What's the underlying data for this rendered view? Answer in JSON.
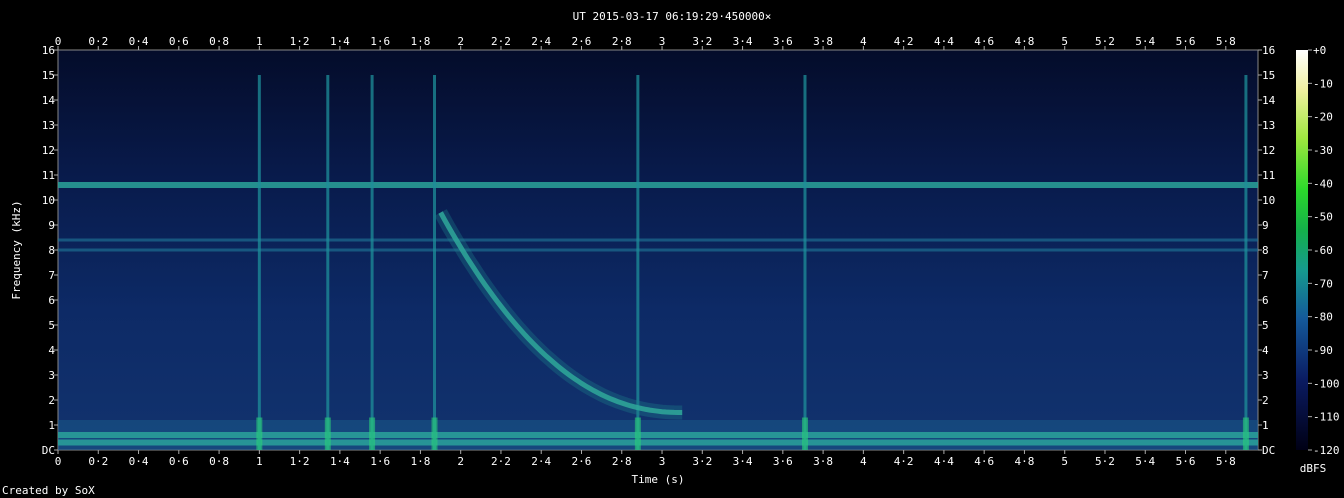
{
  "chart_data": {
    "type": "heatmap",
    "title": "UT 2015-03-17 06:19:29·450000×",
    "xlabel": "Time (s)",
    "ylabel": "Frequency (kHz)",
    "colorbar_label": "dBFS",
    "xlim": [
      0,
      5.96
    ],
    "ylim": [
      0,
      16
    ],
    "x_ticks": [
      "0",
      "0·2",
      "0·4",
      "0·6",
      "0·8",
      "1",
      "1·2",
      "1·4",
      "1·6",
      "1·8",
      "2",
      "2·2",
      "2·4",
      "2·6",
      "2·8",
      "3",
      "3·2",
      "3·4",
      "3·6",
      "3·8",
      "4",
      "4·2",
      "4·4",
      "4·6",
      "4·8",
      "5",
      "5·2",
      "5·4",
      "5·6",
      "5·8"
    ],
    "y_ticks": [
      "DC",
      "1",
      "2",
      "3",
      "4",
      "5",
      "6",
      "7",
      "8",
      "9",
      "10",
      "11",
      "12",
      "13",
      "14",
      "15",
      "16"
    ],
    "colorbar_ticks": [
      "+0",
      "-10",
      "-20",
      "-30",
      "-40",
      "-50",
      "-60",
      "-70",
      "-80",
      "-90",
      "-100",
      "-110",
      "-120"
    ],
    "colorbar_range": [
      -120,
      0
    ],
    "tones_khz": [
      10.6,
      8.4,
      8.0,
      0.3,
      0.6
    ],
    "impulses_s": [
      1.0,
      1.34,
      1.56,
      1.87,
      2.88,
      3.71,
      5.9
    ],
    "whistler": {
      "start_s": 1.9,
      "end_s": 3.1,
      "start_khz": 9.5,
      "end_khz": 1.5
    }
  },
  "footer": {
    "credit": "Created by SoX"
  }
}
